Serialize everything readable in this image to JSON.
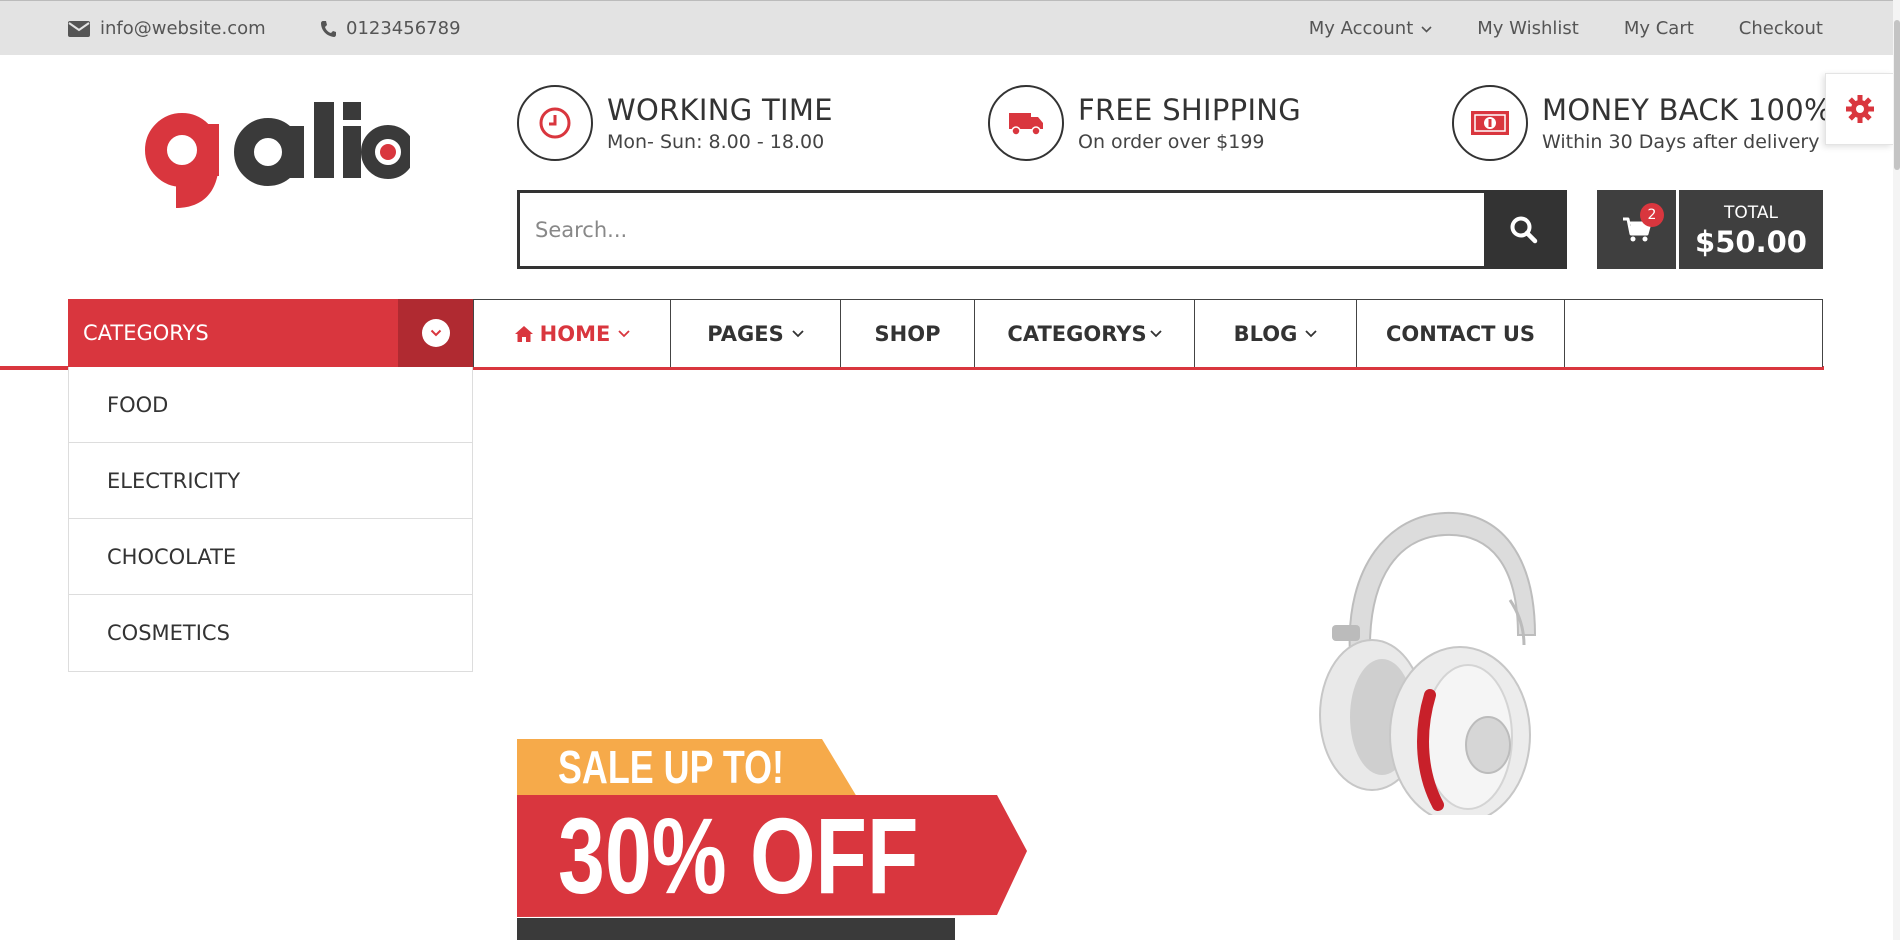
{
  "topbar": {
    "email": "info@website.com",
    "phone": "0123456789",
    "links": [
      "My Account",
      "My Wishlist",
      "My Cart",
      "Checkout"
    ]
  },
  "logo": {
    "text": "galio"
  },
  "info": [
    {
      "title": "WORKING TIME",
      "subtitle": "Mon- Sun: 8.00 - 18.00",
      "icon": "clock-icon"
    },
    {
      "title": "FREE SHIPPING",
      "subtitle": "On order over $199",
      "icon": "truck-icon"
    },
    {
      "title": "MONEY BACK 100%",
      "subtitle": "Within 30 Days after delivery",
      "icon": "money-icon"
    }
  ],
  "search": {
    "placeholder": "Search..."
  },
  "cart": {
    "count": "2",
    "total_label": "TOTAL",
    "total_amount": "$50.00"
  },
  "categories": {
    "label": "CATEGORYS",
    "items": [
      "FOOD",
      "ELECTRICITY",
      "CHOCOLATE",
      "COSMETICS"
    ]
  },
  "nav": [
    {
      "label": "HOME",
      "dropdown": true,
      "active": true
    },
    {
      "label": "PAGES",
      "dropdown": true
    },
    {
      "label": "SHOP",
      "dropdown": false
    },
    {
      "label": "CATEGORYS",
      "dropdown": true
    },
    {
      "label": "BLOG",
      "dropdown": true
    },
    {
      "label": "CONTACT US",
      "dropdown": false
    }
  ],
  "banner": {
    "sale_line": "SALE UP TO!",
    "discount_line": "30% OFF"
  },
  "colors": {
    "accent": "#d9363e",
    "dark": "#333333",
    "orange": "#f6aa4a"
  }
}
